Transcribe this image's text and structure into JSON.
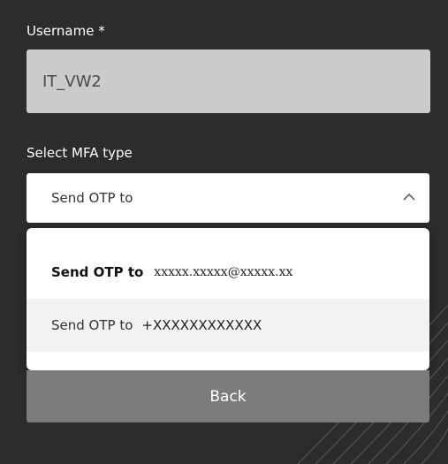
{
  "form": {
    "username_label": "Username *",
    "username_value": "IT_VW2",
    "mfa_label": "Select MFA type",
    "mfa_selected": "Send OTP to"
  },
  "dropdown": {
    "options": [
      {
        "prefix": "Send OTP to",
        "value": "xxxxx.xxxxx@xxxxx.xx"
      },
      {
        "prefix": "Send OTP to",
        "value": "+XXXXXXXXXXXX"
      }
    ]
  },
  "actions": {
    "back_label": "Back"
  },
  "colors": {
    "background": "#2b2c2e",
    "input_disabled": "#cbcbcb",
    "button": "#7c7c7c",
    "focus_accent": "#17b3e6"
  },
  "icons": {
    "select_toggle": "chevron-up-icon"
  }
}
